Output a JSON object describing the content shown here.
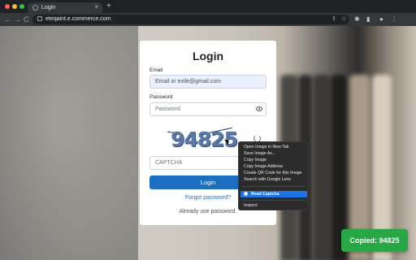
{
  "browser": {
    "tab_title": "Login",
    "tab_close": "×",
    "new_tab": "+",
    "url": "eteqaint.e.commerce.com",
    "nav": {
      "back": "←",
      "forward": "→",
      "reload": "C"
    }
  },
  "login": {
    "title": "Login",
    "email_label": "Email",
    "email_value": "Email or exile@gmail.com",
    "password_label": "Password",
    "password_placeholder": "Password",
    "captcha_image_text": "94825",
    "captcha_placeholder": "CAPTCHA",
    "login_button": "Login",
    "forgot_link": "Forgot password?",
    "already_text": "Already use password."
  },
  "context_menu": {
    "items": [
      "Open Image in New Tab",
      "Save Image As...",
      "Copy Image",
      "Copy Image Address",
      "Create QR Code for this Image",
      "Search with Google Lens"
    ],
    "highlighted": "Read Captcha",
    "last": "Inspect"
  },
  "toast": {
    "text": "Copied: 94825"
  },
  "colors": {
    "primary": "#1b6ec2",
    "toast": "#28a745",
    "menu_highlight": "#1a73e8"
  }
}
